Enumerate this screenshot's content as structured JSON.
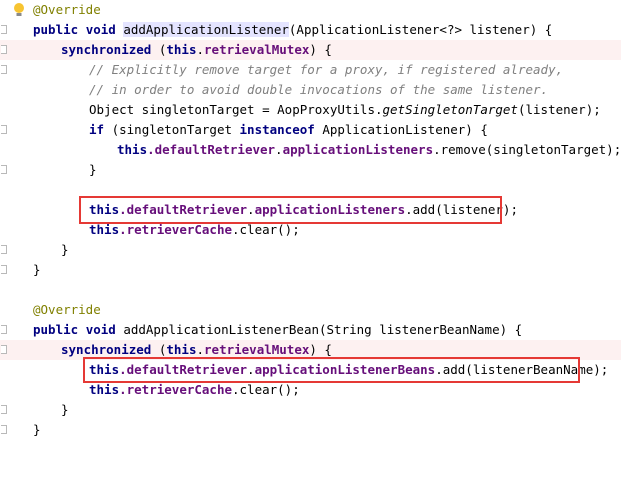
{
  "editor": {
    "lines": [
      {
        "annotation": "@Override"
      },
      {
        "kw1": "public",
        "kw2": "void",
        "method": "addApplicationListener",
        "rest": "(ApplicationListener<?> listener) {"
      },
      {
        "kw": "synchronized",
        "open": " (",
        "this": "this",
        "dot": ".",
        "field": "retrievalMutex",
        "close": ") {"
      },
      {
        "comment": "// Explicitly remove target for a proxy, if registered already,"
      },
      {
        "comment": "// in order to avoid double invocations of the same listener."
      },
      {
        "pre": "Object singletonTarget = AopProxyUtils.",
        "call": "getSingletonTarget",
        "post": "(listener);"
      },
      {
        "kw1": "if",
        "mid1": " (singletonTarget ",
        "kw2": "instanceof",
        "mid2": " ApplicationListener) {"
      },
      {
        "this": "this",
        "f1": ".defaultRetriever",
        "dot": ".",
        "f2": "applicationListeners",
        "rest": ".remove(singletonTarget);"
      },
      {
        "text": "}"
      },
      {
        "this": "this",
        "f1": ".defaultRetriever",
        "dot": ".",
        "f2": "applicationListeners",
        "rest": ".add(listener);"
      },
      {
        "this": "this",
        "f1": ".retrieverCache",
        "rest": ".clear();"
      },
      {
        "text": "}"
      },
      {
        "text": "}"
      },
      {
        "text": ""
      },
      {
        "annotation": "@Override"
      },
      {
        "kw1": "public",
        "kw2": "void",
        "rest": " addApplicationListenerBean(String listenerBeanName) {"
      },
      {
        "kw": "synchronized",
        "open": " (",
        "this": "this",
        "dot": ".",
        "field": "retrievalMutex",
        "close": ") {"
      },
      {
        "this": "this",
        "f1": ".defaultRetriever",
        "dot": ".",
        "f2": "applicationListenerBeans",
        "rest": ".add(listenerBeanName);"
      },
      {
        "this": "this",
        "f1": ".retrieverCache",
        "rest": ".clear();"
      },
      {
        "text": "}"
      },
      {
        "text": "}"
      }
    ]
  },
  "colors": {
    "keyword": "#000080",
    "field": "#660e7a",
    "comment": "#808080",
    "annotation": "#808000",
    "highlight_box": "#e53935",
    "line_highlight": "#fdf1f1"
  }
}
